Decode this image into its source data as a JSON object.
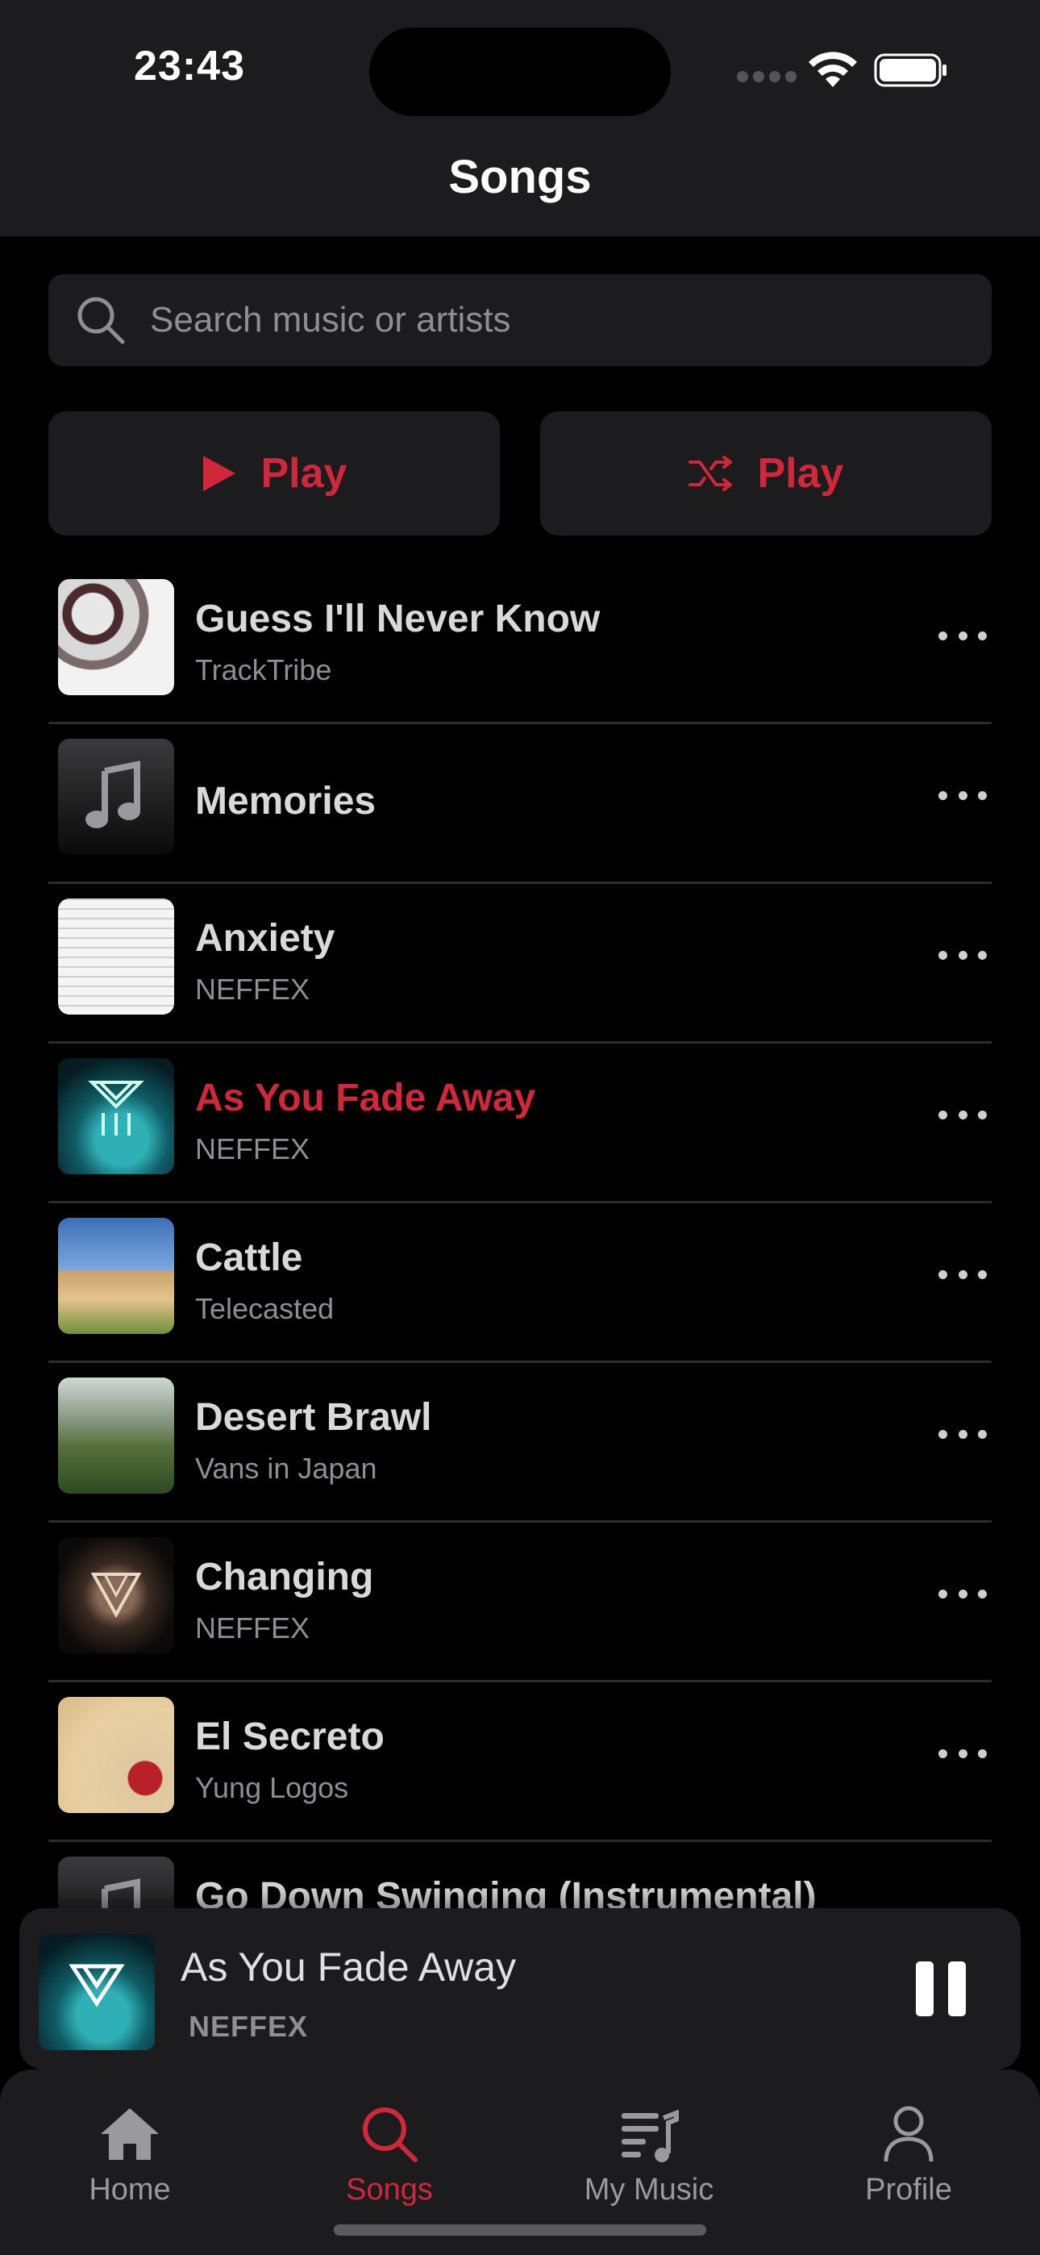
{
  "status_bar": {
    "time": "23:43"
  },
  "header": {
    "title": "Songs"
  },
  "search": {
    "placeholder": "Search music or artists"
  },
  "actions": {
    "play_label": "Play",
    "shuffle_label": "Play"
  },
  "songs": [
    {
      "title": "Guess I'll Never Know",
      "artist": "TrackTribe",
      "art_icon": "abstract-art",
      "active": false
    },
    {
      "title": "Memories",
      "artist": "",
      "art_icon": "music-note-icon",
      "active": false
    },
    {
      "title": "Anxiety",
      "artist": "NEFFEX",
      "art_icon": "sketch-art",
      "active": false
    },
    {
      "title": "As You Fade Away",
      "artist": "NEFFEX",
      "art_icon": "neffex-teal-art",
      "active": true
    },
    {
      "title": "Cattle",
      "artist": "Telecasted",
      "art_icon": "cattle-photo",
      "active": false
    },
    {
      "title": "Desert Brawl",
      "artist": "Vans in Japan",
      "art_icon": "landscape-art",
      "active": false
    },
    {
      "title": "Changing",
      "artist": "NEFFEX",
      "art_icon": "neffex-dark-art",
      "active": false
    },
    {
      "title": "El Secreto",
      "artist": "Yung Logos",
      "art_icon": "beige-art",
      "active": false
    },
    {
      "title": "Go Down Swinging (Instrumental)",
      "artist": "",
      "art_icon": "music-note-icon",
      "active": false
    }
  ],
  "now_playing": {
    "title": "As You Fade Away",
    "artist": "NEFFEX"
  },
  "tabs": [
    {
      "label": "Home",
      "icon": "home-icon",
      "active": false
    },
    {
      "label": "Songs",
      "icon": "search-icon",
      "active": true
    },
    {
      "label": "My Music",
      "icon": "playlist-icon",
      "active": false
    },
    {
      "label": "Profile",
      "icon": "profile-icon",
      "active": false
    }
  ],
  "colors": {
    "accent": "#d0283a",
    "background": "#000000",
    "surface": "#1c1c1e",
    "secondary_text": "#8e8e93"
  }
}
